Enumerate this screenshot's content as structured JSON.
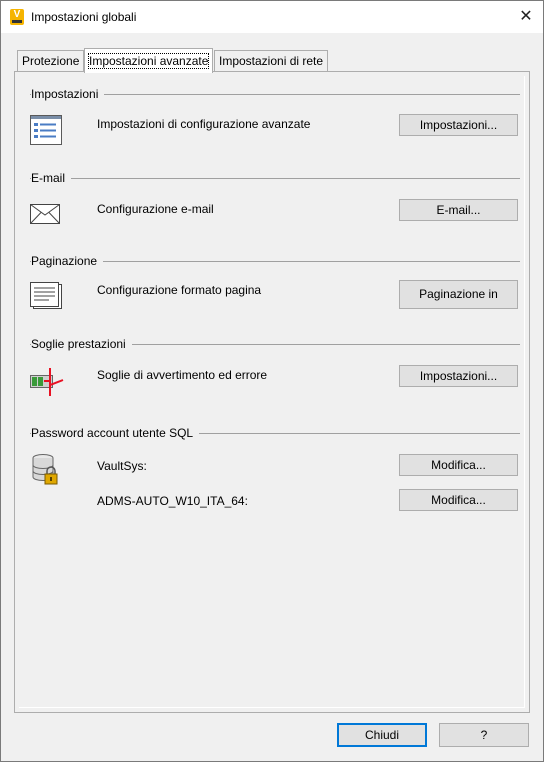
{
  "window": {
    "title": "Impostazioni globali",
    "close": "✕"
  },
  "tabs": [
    {
      "label": "Protezione"
    },
    {
      "label": "Impostazioni avanzate",
      "active": true
    },
    {
      "label": "Impostazioni di rete"
    }
  ],
  "sections": {
    "settings": {
      "title": "Impostazioni",
      "description": "Impostazioni di configurazione avanzate",
      "button": "Impostazioni...",
      "icon": "settings-list-icon"
    },
    "email": {
      "title": "E-mail",
      "description": "Configurazione e-mail",
      "button": "E-mail...",
      "icon": "envelope-icon"
    },
    "pagination": {
      "title": "Paginazione",
      "description": "Configurazione formato pagina",
      "button": "Paginazione in",
      "icon": "page-document-icon"
    },
    "thresholds": {
      "title": "Soglie prestazioni",
      "description": "Soglie di avvertimento ed errore",
      "button": "Impostazioni...",
      "icon": "performance-threshold-icon"
    },
    "sql": {
      "title": "Password account utente SQL",
      "icon": "database-lock-icon",
      "accounts": [
        {
          "name": "VaultSys:",
          "button": "Modifica..."
        },
        {
          "name": "ADMS-AUTO_W10_ITA_64:",
          "button": "Modifica..."
        }
      ]
    }
  },
  "footer": {
    "close": "Chiudi",
    "help": "?"
  },
  "colors": {
    "accent": "#0078d7",
    "brand": "#f5b400",
    "alert": "#e81123",
    "ok": "#3a9a3a"
  }
}
